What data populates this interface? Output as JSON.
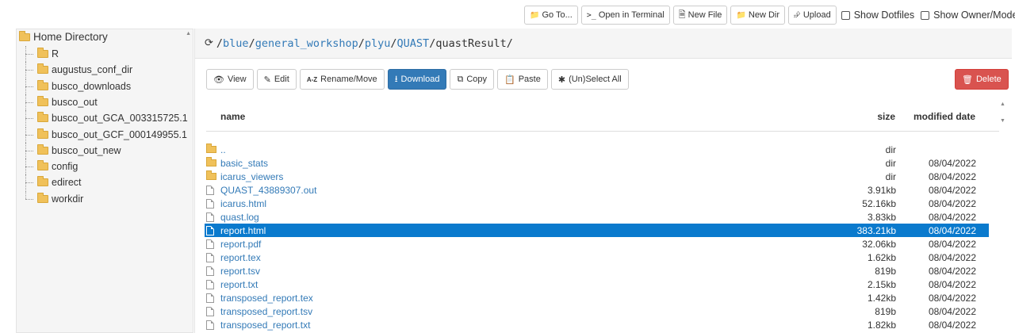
{
  "toolbar": {
    "goto_label": "Go To...",
    "terminal_label": "Open in Terminal",
    "newfile_label": "New File",
    "newdir_label": "New Dir",
    "upload_label": "Upload",
    "show_dotfiles_label": "Show Dotfiles",
    "show_owner_label": "Show Owner/Mode"
  },
  "sidebar": {
    "root_label": "Home Directory",
    "items": [
      {
        "label": "R"
      },
      {
        "label": "augustus_conf_dir"
      },
      {
        "label": "busco_downloads"
      },
      {
        "label": "busco_out"
      },
      {
        "label": "busco_out_GCA_003315725.1"
      },
      {
        "label": "busco_out_GCF_000149955.1"
      },
      {
        "label": "busco_out_new"
      },
      {
        "label": "config"
      },
      {
        "label": "edirect"
      },
      {
        "label": "workdir"
      }
    ]
  },
  "path": {
    "segments": [
      "blue",
      "general_workshop",
      "plyu",
      "QUAST"
    ],
    "current": "quastResult",
    "separator": "/"
  },
  "actions": {
    "view_label": "View",
    "edit_label": "Edit",
    "rename_label": "Rename/Move",
    "download_label": "Download",
    "copy_label": "Copy",
    "paste_label": "Paste",
    "select_label": "(Un)Select All",
    "delete_label": "Delete"
  },
  "table": {
    "headers": {
      "name": "name",
      "size": "size",
      "date": "modified date"
    },
    "rows": [
      {
        "type": "folder",
        "name": "..",
        "size": "dir",
        "date": ""
      },
      {
        "type": "folder",
        "name": "basic_stats",
        "size": "dir",
        "date": "08/04/2022"
      },
      {
        "type": "folder",
        "name": "icarus_viewers",
        "size": "dir",
        "date": "08/04/2022"
      },
      {
        "type": "file",
        "name": "QUAST_43889307.out",
        "size": "3.91kb",
        "date": "08/04/2022"
      },
      {
        "type": "file",
        "name": "icarus.html",
        "size": "52.16kb",
        "date": "08/04/2022"
      },
      {
        "type": "file",
        "name": "quast.log",
        "size": "3.83kb",
        "date": "08/04/2022"
      },
      {
        "type": "file",
        "name": "report.html",
        "size": "383.21kb",
        "date": "08/04/2022",
        "selected": true
      },
      {
        "type": "file",
        "name": "report.pdf",
        "size": "32.06kb",
        "date": "08/04/2022"
      },
      {
        "type": "file",
        "name": "report.tex",
        "size": "1.62kb",
        "date": "08/04/2022"
      },
      {
        "type": "file",
        "name": "report.tsv",
        "size": "819b",
        "date": "08/04/2022"
      },
      {
        "type": "file",
        "name": "report.txt",
        "size": "2.15kb",
        "date": "08/04/2022"
      },
      {
        "type": "file",
        "name": "transposed_report.tex",
        "size": "1.42kb",
        "date": "08/04/2022"
      },
      {
        "type": "file",
        "name": "transposed_report.tsv",
        "size": "819b",
        "date": "08/04/2022"
      },
      {
        "type": "file",
        "name": "transposed_report.txt",
        "size": "1.82kb",
        "date": "08/04/2022"
      }
    ]
  },
  "colors": {
    "link": "#337ab7",
    "primary": "#337ab7",
    "danger": "#d9534f",
    "selected_row": "#0a7acd",
    "folder": "#f0c15a"
  }
}
